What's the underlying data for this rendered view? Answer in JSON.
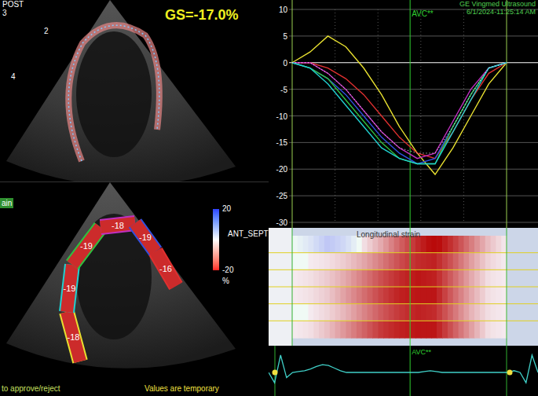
{
  "top_view": {
    "labels": [
      {
        "text": "POST"
      },
      {
        "text": "3"
      }
    ],
    "wall_marks": [
      "2",
      "4"
    ],
    "global_strain": "GS=-17.0%"
  },
  "strain_view": {
    "mode_tab": "ain",
    "view": "ANT_SEPT",
    "scale": {
      "max": "20",
      "min": "-20",
      "unit": "%"
    },
    "segments": [
      {
        "value": "-18",
        "color": "#e8e030"
      },
      {
        "value": "-19",
        "color": "#20d0d0"
      },
      {
        "value": "-19",
        "color": "#30c040"
      },
      {
        "value": "-18",
        "color": "#c030c0"
      },
      {
        "value": "-19",
        "color": "#3050e0"
      },
      {
        "value": "-16",
        "color": "#e03030"
      }
    ],
    "footer_left": "to approve/reject",
    "footer_center": "Values are temporary"
  },
  "chart": {
    "vendor": "GE Vingmed Ultrasound",
    "timestamp": "6/1/2024-11:25:14 AM",
    "marker": "AVC**",
    "marker_index": 6.6,
    "y_ticks": [
      "10",
      "5",
      "0",
      "-5",
      "-10",
      "-15",
      "-20",
      "-25",
      "-30"
    ],
    "series": [
      {
        "color": "#e8e030",
        "dotted": false,
        "values": [
          0,
          2,
          5,
          3,
          -1,
          -6,
          -12,
          -17,
          -21,
          -16,
          -10,
          -4,
          0
        ]
      },
      {
        "color": "#e03030",
        "dotted": false,
        "values": [
          0,
          0,
          -1,
          -3,
          -6,
          -10,
          -14,
          -17,
          -18,
          -13,
          -7,
          -2,
          0
        ]
      },
      {
        "color": "#3050e0",
        "dotted": false,
        "values": [
          0,
          -1,
          -3,
          -6,
          -10,
          -14,
          -17,
          -19,
          -18,
          -12,
          -6,
          -1,
          0
        ]
      },
      {
        "color": "#30c040",
        "dotted": false,
        "values": [
          0,
          -1,
          -3,
          -7,
          -11,
          -15,
          -18,
          -19,
          -19,
          -12,
          -6,
          -1,
          0
        ]
      },
      {
        "color": "#c030c0",
        "dotted": false,
        "values": [
          0,
          0,
          -2,
          -5,
          -9,
          -13,
          -16,
          -18,
          -17,
          -11,
          -5,
          -1,
          0
        ]
      },
      {
        "color": "#20d0d0",
        "dotted": false,
        "values": [
          0,
          -1,
          -4,
          -8,
          -12,
          -16,
          -18,
          -19,
          -19,
          -13,
          -7,
          -1,
          0
        ]
      },
      {
        "color": "#ffffff",
        "dotted": true,
        "values": [
          0,
          0,
          -2,
          -5,
          -9,
          -13,
          -16,
          -17,
          -17,
          -12,
          -6,
          -1,
          0
        ]
      }
    ]
  },
  "strain_map": {
    "title": "Longitudinal strain"
  },
  "ecg": {
    "marker": "AVC**",
    "values": [
      0,
      -0.6,
      1.0,
      -0.3,
      0,
      0.05,
      0.1,
      0.2,
      0.35,
      0.45,
      0.4,
      0.25,
      0.1,
      0,
      0,
      0,
      0,
      0,
      0,
      0,
      0,
      0,
      0,
      0,
      0,
      0,
      0.05,
      0.1,
      0.05,
      0,
      0,
      0,
      0,
      0,
      0,
      0,
      0,
      0,
      0,
      0,
      0,
      0.1,
      0,
      -0.6,
      1.0,
      0
    ]
  }
}
